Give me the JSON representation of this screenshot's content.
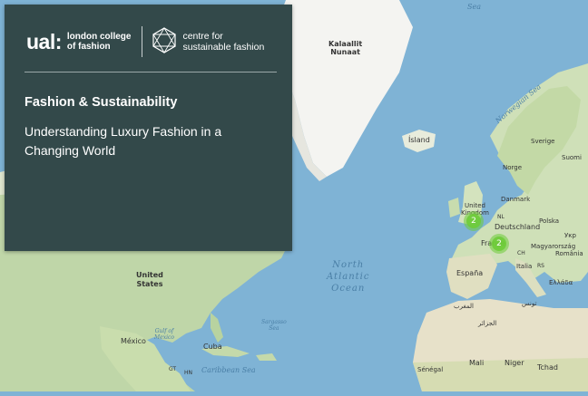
{
  "panel": {
    "logo_ual": "ual:",
    "logo_lcf_line1": "london college",
    "logo_lcf_line2": "of fashion",
    "logo_csf_line1": "centre for",
    "logo_csf_line2": "sustainable fashion",
    "title": "Fashion & Sustainability",
    "subtitle": "Understanding Luxury Fashion in a Changing World"
  },
  "map": {
    "labels": {
      "kalaallit_1": "Kalaallit",
      "kalaallit_2": "Nunaat",
      "island": "Ísland",
      "united_states_1": "United",
      "united_states_2": "States",
      "mexico": "México",
      "cuba": "Cuba",
      "gt": "GT",
      "hn": "HN",
      "united_kingdom_1": "United",
      "united_kingdom_2": "Kingdom",
      "nl": "NL",
      "deutschland": "Deutschland",
      "polska": "Polska",
      "danmark": "Danmark",
      "norge": "Norge",
      "sverige": "Sverige",
      "suomi": "Suomi",
      "france": "France",
      "ch": "CH",
      "magyarorszag": "Magyarország",
      "romania": "România",
      "ukraine": "Укр",
      "espana": "España",
      "italia": "Italia",
      "ellada": "Ελλάδα",
      "rs": "RS",
      "morocco": "المغرب",
      "algeria": "الجزائر",
      "mali": "Mali",
      "niger": "Niger",
      "tchad": "Tchad",
      "senegal": "Sénégal",
      "tunisia": "تونس"
    },
    "oceans": {
      "north_atlantic_1": "North",
      "north_atlantic_2": "Atlantic",
      "north_atlantic_3": "Ocean",
      "norwegian_sea": "Norwegian Sea",
      "sargasso_1": "Sargasso",
      "sargasso_2": "Sea",
      "gulf_1": "Gulf of",
      "gulf_2": "Mexico",
      "caribbean": "Caribbean Sea",
      "sea_top": "Sea"
    },
    "clusters": [
      {
        "count": "2"
      },
      {
        "count": "2"
      }
    ]
  },
  "colors": {
    "water": "#7fb3d5",
    "land": "#dcdcc2",
    "land_green": "#a9c99a",
    "ice": "#f4f4f1",
    "panel": "#33494a",
    "cluster": "#6ecc39"
  }
}
